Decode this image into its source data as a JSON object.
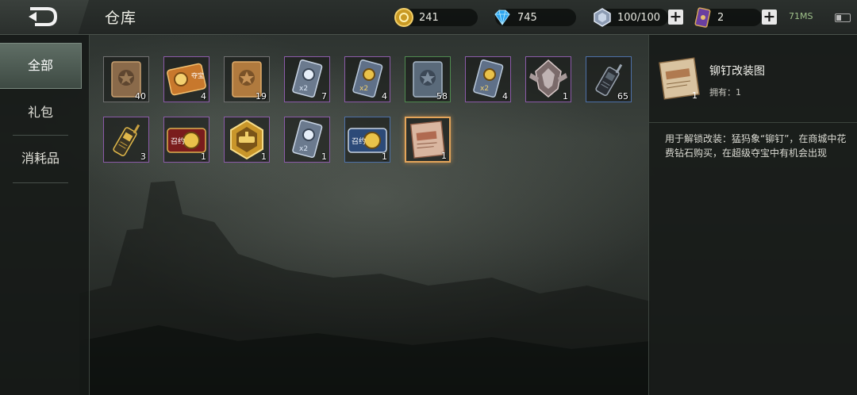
{
  "header": {
    "title": "仓库",
    "gold": "241",
    "diamonds": "745",
    "energy": "100/100",
    "tickets": "2",
    "net_status": "71MS"
  },
  "sidebar": {
    "tabs": [
      {
        "label": "全部",
        "active": true
      },
      {
        "label": "礼包",
        "active": false
      },
      {
        "label": "消耗品",
        "active": false
      }
    ]
  },
  "items": [
    {
      "name": "bronze-star-book",
      "count": "40",
      "rarity": "gray"
    },
    {
      "name": "treasure-ticket",
      "label": "夺宝",
      "count": "4",
      "rarity": "purple"
    },
    {
      "name": "bronze-star-book-2",
      "count": "19",
      "rarity": "gray"
    },
    {
      "name": "silver-card-x2",
      "badge": "x2",
      "count": "7",
      "rarity": "purple"
    },
    {
      "name": "gold-card-x2",
      "badge": "x2",
      "count": "4",
      "rarity": "purple"
    },
    {
      "name": "steel-star-book",
      "count": "58",
      "rarity": "green"
    },
    {
      "name": "gold-card-x2-b",
      "badge": "x2",
      "count": "4",
      "rarity": "purple"
    },
    {
      "name": "rank-emblem",
      "count": "1",
      "rarity": "purple"
    },
    {
      "name": "radio-black",
      "count": "65",
      "rarity": "blue"
    },
    {
      "name": "radio-gold",
      "count": "3",
      "rarity": "purple"
    },
    {
      "name": "summon-gold-ticket",
      "label": "召约",
      "count": "1",
      "rarity": "purple"
    },
    {
      "name": "gold-hex-badge",
      "count": "1",
      "rarity": "purple"
    },
    {
      "name": "silver-card-x2-b",
      "badge": "x2",
      "count": "1",
      "rarity": "purple"
    },
    {
      "name": "summon-silver-ticket",
      "label": "召约",
      "count": "1",
      "rarity": "blue"
    },
    {
      "name": "rivet-blueprint",
      "count": "1",
      "rarity": "gold",
      "selected": true
    }
  ],
  "detail": {
    "name": "铆钉改装图",
    "count": "1",
    "owned": "拥有：1",
    "description": "用于解锁改装：猛犸象“铆钉”，在商城中花费钻石购买，在超级夺宝中有机会出现"
  },
  "colors": {
    "accent_selected": "#e3a45a",
    "rarity_purple": "#8b5aa8",
    "rarity_green": "#4f8a4f",
    "rarity_blue": "#4d70a8"
  }
}
